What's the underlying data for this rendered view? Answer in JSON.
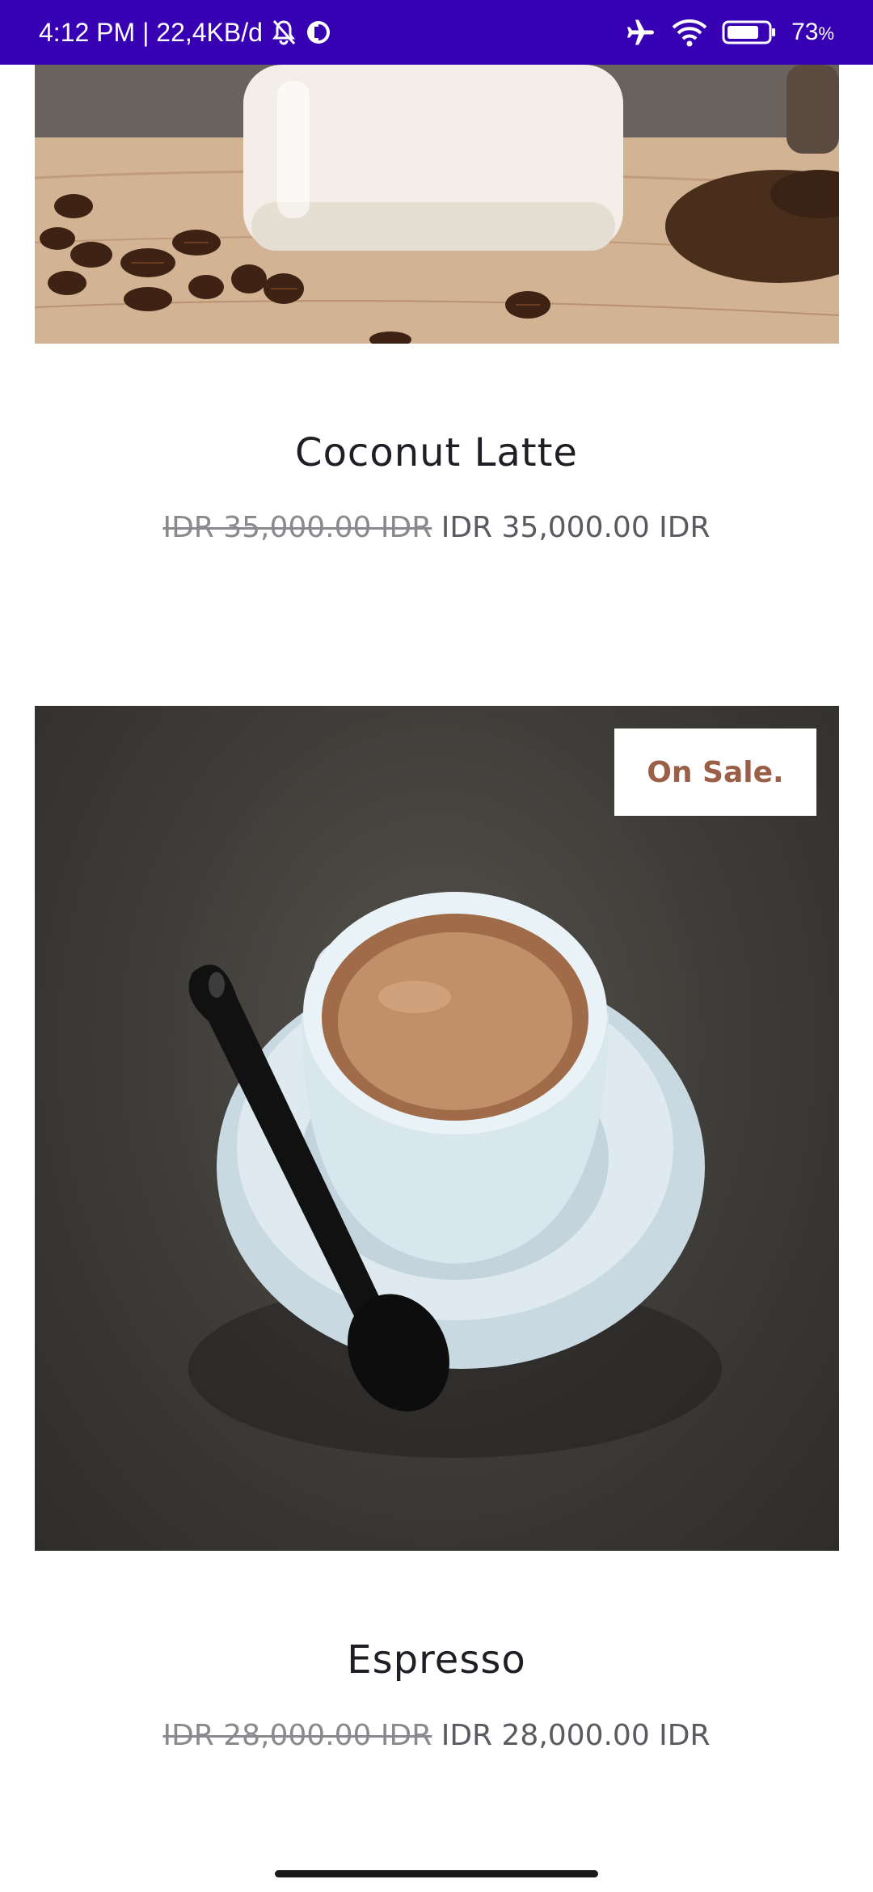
{
  "status_bar": {
    "time_info": "4:12 PM | 22,4KB/d",
    "battery_value": "73",
    "battery_unit": "%",
    "icons": [
      "muted-bell-icon",
      "data-saver-icon",
      "airplane-icon",
      "wifi-icon",
      "battery-icon"
    ]
  },
  "products": [
    {
      "name": "Coconut Latte",
      "old_price": "IDR 35,000.00 IDR",
      "price": "IDR 35,000.00 IDR"
    },
    {
      "name": "Espresso",
      "badge": "On Sale.",
      "old_price": "IDR 28,000.00 IDR",
      "price": "IDR 28,000.00 IDR"
    }
  ],
  "colors": {
    "status_bar": "#3700b3",
    "badge_text": "#9b5f47",
    "text_primary": "#1e1e24",
    "text_price": "#5a5a60"
  }
}
